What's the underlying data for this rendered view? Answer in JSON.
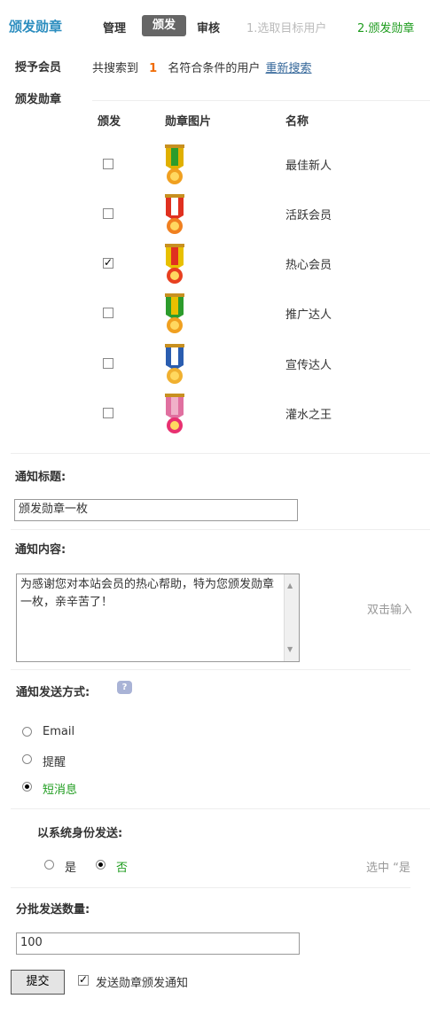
{
  "header": {
    "title": "颁发勋章",
    "tabs": [
      "管理",
      "颁发",
      "审核"
    ],
    "steps": [
      "1.选取目标用户",
      "2.颁发勋章"
    ]
  },
  "grant_member": {
    "label": "授予会员",
    "text_before": "共搜索到",
    "count": "1",
    "text_after": "名符合条件的用户",
    "research_link": "重新搜索"
  },
  "medals": {
    "label": "颁发勋章",
    "columns": [
      "颁发",
      "勋章图片",
      "名称"
    ],
    "rows": [
      {
        "name": "最佳新人",
        "checked": false
      },
      {
        "name": "活跃会员",
        "checked": false
      },
      {
        "name": "热心会员",
        "checked": true
      },
      {
        "name": "推广达人",
        "checked": false
      },
      {
        "name": "宣传达人",
        "checked": false
      },
      {
        "name": "灌水之王",
        "checked": false
      }
    ]
  },
  "notify_title": {
    "label": "通知标题:",
    "value": "颁发勋章一枚"
  },
  "notify_content": {
    "label": "通知内容:",
    "value": "为感谢您对本站会员的热心帮助，特为您颁发勋章一枚，亲辛苦了！",
    "hint": "双击输入"
  },
  "send_method": {
    "label": "通知发送方式:",
    "options": [
      "Email",
      "提醒",
      "短消息"
    ],
    "selected": "短消息"
  },
  "system_send": {
    "label": "以系统身份发送:",
    "options": [
      "是",
      "否"
    ],
    "selected": "否",
    "hint": "选中 “是"
  },
  "batch": {
    "label": "分批发送数量:",
    "value": "100"
  },
  "footer": {
    "submit": "提交",
    "send_notice_label": "发送勋章颁发通知",
    "send_notice_checked": true
  },
  "colors": {
    "title": "#2b8dbf",
    "active_tab_bg": "#666666",
    "step_active": "#1e9c1e",
    "count": "#f06a00"
  }
}
